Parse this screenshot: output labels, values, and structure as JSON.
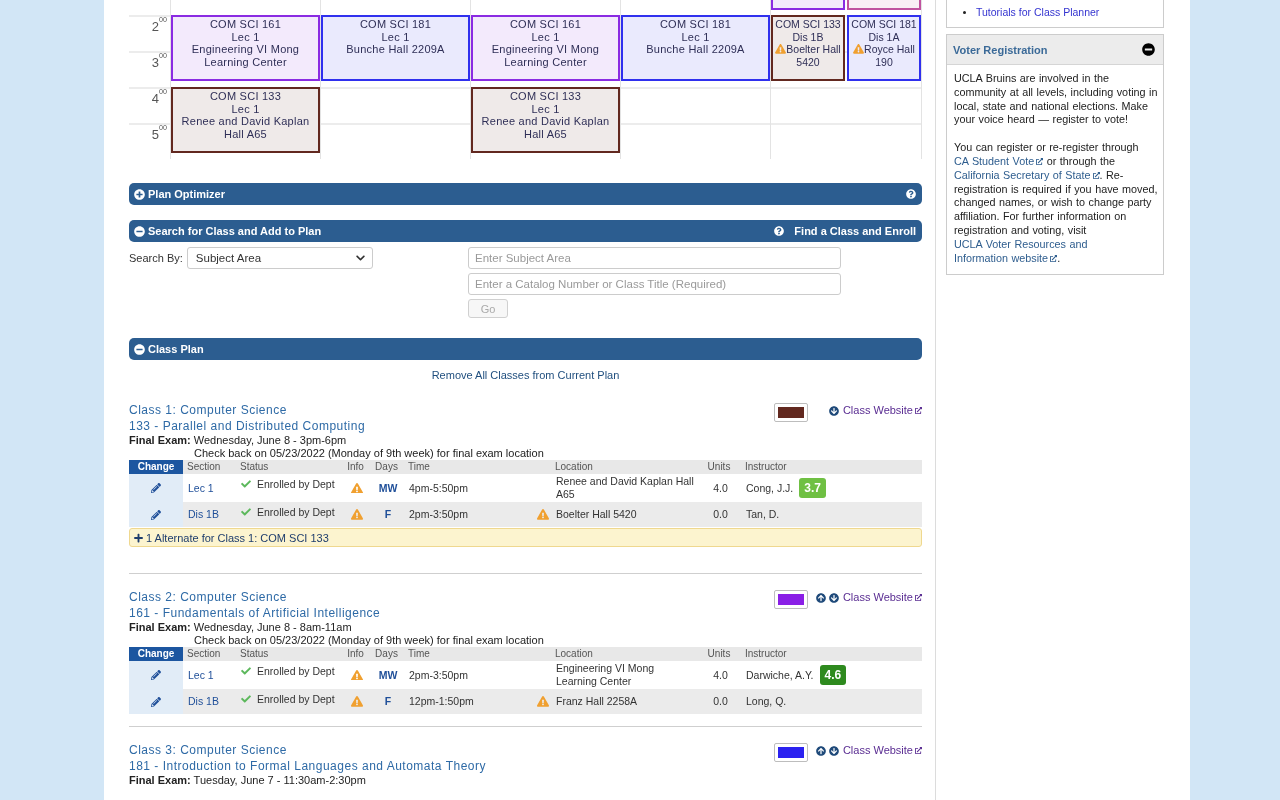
{
  "calendar": {
    "bands": [
      {
        "days": [
          {
            "kind": "empty"
          },
          {
            "kind": "empty"
          },
          {
            "kind": "empty"
          },
          {
            "kind": "empty"
          },
          {
            "kind": "events",
            "events": [
              {
                "color": "#8a2be2"
              },
              {
                "color": "#c0529f"
              }
            ]
          }
        ]
      },
      {
        "hours": [
          "2$^{00}$",
          "3$^{00}$"
        ],
        "days": [
          {
            "kind": "events",
            "events": [
              {
                "course": "COM SCI 161",
                "section": "Lec 1",
                "location": "Engineering VI Mong Learning Center",
                "warning": false,
                "color": "#8a2be2"
              }
            ]
          },
          {
            "kind": "events",
            "events": [
              {
                "course": "COM SCI 181",
                "section": "Lec 1",
                "location": "Bunche Hall 2209A",
                "warning": false,
                "color": "#3030ee"
              }
            ]
          },
          {
            "kind": "events",
            "events": [
              {
                "course": "COM SCI 161",
                "section": "Lec 1",
                "location": "Engineering VI Mong Learning Center",
                "warning": false,
                "color": "#8a2be2"
              }
            ]
          },
          {
            "kind": "events",
            "events": [
              {
                "course": "COM SCI 181",
                "section": "Lec 1",
                "location": "Bunche Hall 2209A",
                "warning": false,
                "color": "#3030ee"
              }
            ]
          },
          {
            "kind": "events",
            "events": [
              {
                "course": "COM SCI 133",
                "section": "Dis 1B",
                "location": "Boelter Hall 5420",
                "warning": true,
                "color": "#62281f"
              },
              {
                "course": "COM SCI 181",
                "section": "Dis 1A",
                "location": "Royce Hall 190",
                "warning": true,
                "color": "#3030ee"
              }
            ]
          }
        ]
      },
      {
        "hours": [
          "4$^{00}$",
          "5$^{00}$"
        ],
        "days": [
          {
            "kind": "events",
            "events": [
              {
                "course": "COM SCI 133",
                "section": "Lec 1",
                "location": "Renee and David Kaplan Hall A65",
                "warning": false,
                "color": "#62281f"
              }
            ]
          },
          {
            "kind": "empty"
          },
          {
            "kind": "events",
            "events": [
              {
                "course": "COM SCI 133",
                "section": "Lec 1",
                "location": "Renee and David Kaplan Hall A65",
                "warning": false,
                "color": "#62281f"
              }
            ]
          },
          {
            "kind": "empty"
          },
          {
            "kind": "empty"
          }
        ]
      }
    ]
  },
  "plan_optimizer": {
    "title": "Plan Optimizer",
    "expanded": false,
    "help": true
  },
  "search_panel": {
    "title": "Search for Class and Add to Plan",
    "expanded": true,
    "help": true,
    "link": "Find a Class and Enroll",
    "search_by_label": "Search By:",
    "search_by": "Subject Area",
    "subject_field": {
      "placeholder": "Enter Subject Area"
    },
    "catalog_field": {
      "placeholder": "Enter a Catalog Number or Class Title (Required)"
    },
    "go_button": {
      "label": "Go",
      "disabled": true
    }
  },
  "class_plan": {
    "title": "Class Plan",
    "expanded": true,
    "help": false,
    "remove_all": "Remove All Classes from Current Plan",
    "classes": [
      {
        "title": "Class 1: Computer Science",
        "course": "133 - Parallel and Distributed Computing",
        "final_exam": "**Final Exam:** Wednesday, June 8 - 3pm-6pm",
        "exam_note": "Check back on 05/23/2022 (Monday of 9th week) for final exam location",
        "color": "#62281f",
        "move_up": false,
        "move_down": true,
        "website": "Class Website",
        "columns": [
          "Change",
          "Section",
          "Status",
          "Info",
          "Days",
          "Time",
          "Location",
          "Units",
          "Instructor"
        ],
        "sections": [
          {
            "section": "Lec 1",
            "status": "Enrolled by Dept",
            "info_warning": true,
            "days": "MW",
            "time": "4pm-5:50pm",
            "location_warning": false,
            "location": "Renee and David Kaplan Hall A65",
            "units": "4.0",
            "instructor": "Cong, J.J.",
            "rating": {
              "value": "3.7",
              "color": "#6fc043"
            }
          },
          {
            "section": "Dis 1B",
            "status": "Enrolled by Dept",
            "info_warning": true,
            "days": "F",
            "time": "2pm-3:50pm",
            "location_warning": true,
            "location": "Boelter Hall 5420",
            "units": "0.0",
            "instructor": "Tan, D."
          }
        ],
        "alternates": "1 Alternate for Class 1: COM SCI 133"
      },
      {
        "title": "Class 2: Computer Science",
        "course": "161 - Fundamentals of Artificial Intelligence",
        "final_exam": "**Final Exam:** Wednesday, June 8 - 8am-11am",
        "exam_note": "Check back on 05/23/2022 (Monday of 9th week) for final exam location",
        "color": "#8a1fe6",
        "move_up": true,
        "move_down": true,
        "website": "Class Website",
        "columns": [
          "Change",
          "Section",
          "Status",
          "Info",
          "Days",
          "Time",
          "Location",
          "Units",
          "Instructor"
        ],
        "sections": [
          {
            "section": "Lec 1",
            "status": "Enrolled by Dept",
            "info_warning": true,
            "days": "MW",
            "time": "2pm-3:50pm",
            "location_warning": false,
            "location": "Engineering VI Mong Learning Center",
            "units": "4.0",
            "instructor": "Darwiche, A.Y.",
            "rating": {
              "value": "4.6",
              "color": "#2e8a1e"
            }
          },
          {
            "section": "Dis 1B",
            "status": "Enrolled by Dept",
            "info_warning": true,
            "days": "F",
            "time": "12pm-1:50pm",
            "location_warning": true,
            "location": "Franz Hall 2258A",
            "units": "0.0",
            "instructor": "Long, Q."
          }
        ]
      },
      {
        "title": "Class 3: Computer Science",
        "course": "181 - Introduction to Formal Languages and Automata Theory",
        "final_exam": "**Final Exam:** Tuesday, June 7 - 11:30am-2:30pm",
        "color": "#2b22f0",
        "move_up": true,
        "move_down": true,
        "website": "Class Website"
      }
    ]
  },
  "sidebar": {
    "links": [
      "Tutorials for Class Planner"
    ],
    "voter_registration": {
      "title": "Voter Registration",
      "expanded": true,
      "intro": "UCLA Bruins are involved in the community at all levels, including voting in local, state and national elections. Make your voice heard — register to vote!",
      "body": [
        {
          "kind": "text",
          "text": "You can register or re-register through "
        },
        {
          "kind": "link",
          "parts": [
            "CA Student Vote"
          ],
          "external": true
        },
        {
          "kind": "text",
          "text": " or through the "
        },
        {
          "kind": "link",
          "parts": [
            "California Secretary of State"
          ],
          "external": true
        },
        {
          "kind": "text",
          "text": ". Re-registration is required if you have moved, changed names, or wish to change party affiliation. For further information on registration and voting, visit "
        },
        {
          "kind": "link",
          "parts": [
            "UCLA Voter Resources and",
            "Information website"
          ],
          "external": true
        },
        {
          "kind": "text",
          "text": "."
        }
      ]
    }
  }
}
